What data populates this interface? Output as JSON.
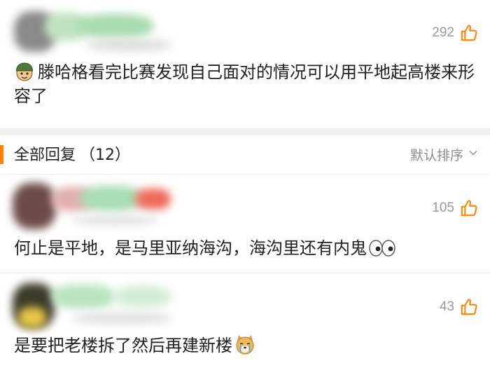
{
  "main_comment": {
    "like_count": "292",
    "text": "滕哈格看完比赛发现自己面对的情况可以用平地起高楼来形容了"
  },
  "replies_header": {
    "title": "全部回复",
    "count": "（12）",
    "sort_label": "默认排序"
  },
  "replies": [
    {
      "like_count": "105",
      "text": "何止是平地，是马里亚纳海沟，海沟里还有内鬼"
    },
    {
      "like_count": "43",
      "text": "是要把老楼拆了然后再建新楼"
    }
  ],
  "colors": {
    "accent": "#ff8200",
    "count_gray": "#9a9a9a",
    "divider": "#efefef"
  },
  "icons": [
    "thumbs-up-icon",
    "soldier-emoji-icon",
    "eyes-emoji-icon",
    "crying-dog-emoji-icon",
    "chevron-down-icon"
  ]
}
